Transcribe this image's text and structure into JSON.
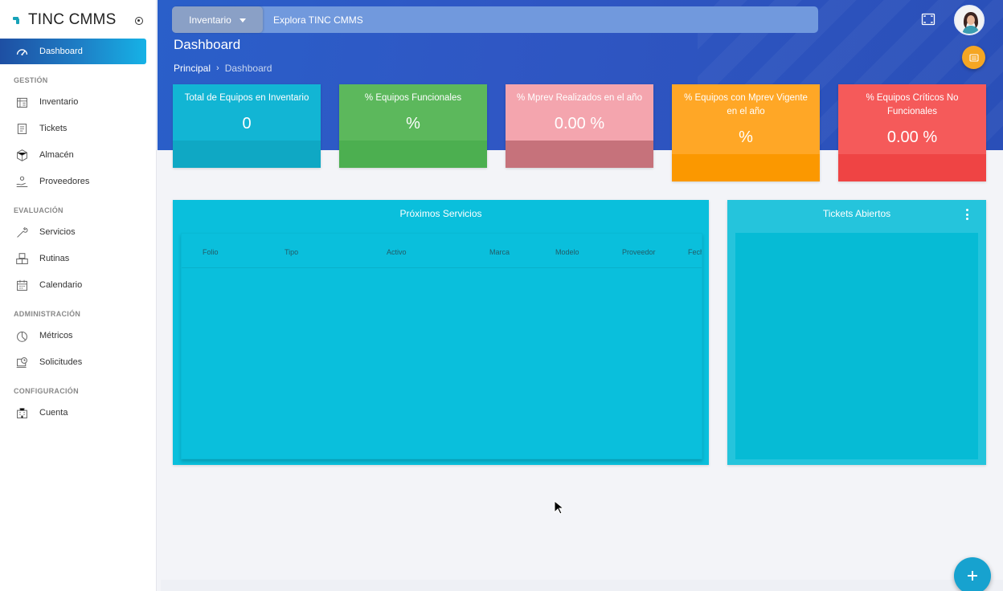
{
  "brand": {
    "name": "TINC CMMS"
  },
  "sidebar": {
    "active": {
      "label": "Dashboard",
      "icon": "speedometer-icon"
    },
    "sections": [
      {
        "title": "GESTIÓN",
        "items": [
          {
            "label": "Inventario",
            "icon": "inventory-icon"
          },
          {
            "label": "Tickets",
            "icon": "ticket-icon"
          },
          {
            "label": "Almacén",
            "icon": "box-icon"
          },
          {
            "label": "Proveedores",
            "icon": "supplier-icon"
          }
        ]
      },
      {
        "title": "EVALUACIÓN",
        "items": [
          {
            "label": "Servicios",
            "icon": "wrench-icon"
          },
          {
            "label": "Rutinas",
            "icon": "boxes-icon"
          },
          {
            "label": "Calendario",
            "icon": "calendar-icon"
          }
        ]
      },
      {
        "title": "ADMINISTRACIÓN",
        "items": [
          {
            "label": "Métricos",
            "icon": "pie-chart-icon"
          },
          {
            "label": "Solicitudes",
            "icon": "request-icon"
          }
        ]
      },
      {
        "title": "CONFIGURACIÓN",
        "items": [
          {
            "label": "Cuenta",
            "icon": "building-icon"
          }
        ]
      }
    ]
  },
  "header": {
    "module_label": "Inventario",
    "search_placeholder": "Explora TINC CMMS",
    "page_title": "Dashboard",
    "breadcrumb": [
      "Principal",
      "Dashboard"
    ]
  },
  "kpis": [
    {
      "title": "Total de Equipos en Inventario",
      "value": "0",
      "color": "#12b5d4",
      "foot_color": "#0fa8c4"
    },
    {
      "title": "% Equipos Funcionales",
      "value": "%",
      "color": "#5cb85c",
      "foot_color": "#4caf50"
    },
    {
      "title": "% Mprev Realizados en el año",
      "value": "0.00 %",
      "color": "#f4a5ae",
      "foot_color": "#c6727b"
    },
    {
      "title": "% Equipos con Mprev Vigente en el año",
      "value": "%",
      "color": "#ffa726",
      "foot_color": "#fb9800"
    },
    {
      "title": "% Equipos Críticos No Funcionales",
      "value": "0.00 %",
      "color": "#f55a5a",
      "foot_color": "#ef4444"
    }
  ],
  "services_panel": {
    "title": "Próximos Servicios",
    "columns": [
      "Folio",
      "Tipo",
      "Activo",
      "Marca",
      "Modelo",
      "Proveedor",
      "Fech"
    ]
  },
  "tickets_panel": {
    "title": "Tickets Abiertos"
  },
  "colors": {
    "banner": "#2a5fc9",
    "panel": "#0abfdc",
    "accent_orange": "#f5a623",
    "fab_blue": "#17a2cf"
  }
}
